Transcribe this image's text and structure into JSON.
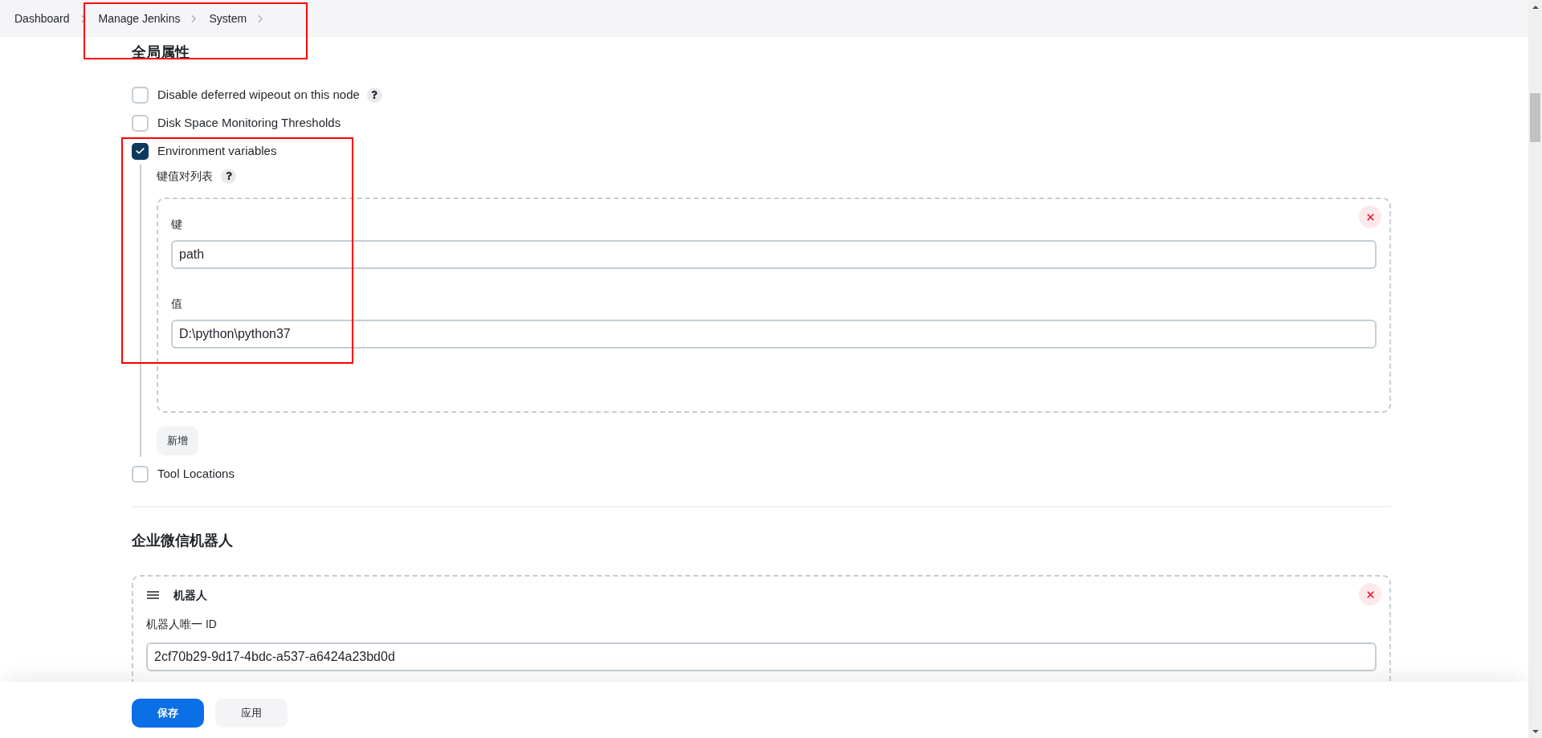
{
  "breadcrumb": {
    "highlighted": true,
    "items": [
      {
        "label": "Dashboard"
      },
      {
        "label": "Manage Jenkins"
      },
      {
        "label": "System"
      }
    ]
  },
  "global_properties": {
    "title": "全局属性",
    "options": [
      {
        "label": "Disable deferred wipeout on this node",
        "checked": false,
        "help": true,
        "highlighted": false
      },
      {
        "label": "Disk Space Monitoring Thresholds",
        "checked": false,
        "help": false,
        "highlighted": false
      },
      {
        "label": "Environment variables",
        "checked": true,
        "help": false,
        "highlighted": true,
        "settings": {
          "list_label": "键值对列表",
          "list_help": true,
          "entries": [
            {
              "fields": [
                {
                  "label": "键",
                  "value": "path"
                },
                {
                  "label": "值",
                  "value": "D:\\python\\python37"
                }
              ]
            }
          ],
          "add_button": "新增"
        }
      },
      {
        "label": "Tool Locations",
        "checked": false,
        "help": false,
        "highlighted": false
      }
    ]
  },
  "wecom_robot": {
    "title": "企业微信机器人",
    "robots": [
      {
        "name": "机器人",
        "fields": [
          {
            "label": "机器人唯一 ID",
            "value": "2cf70b29-9d17-4bdc-a537-a6424a23bd0d"
          }
        ]
      }
    ]
  },
  "footer": {
    "buttons": [
      {
        "label": "保存",
        "kind": "primary"
      },
      {
        "label": "应用",
        "kind": "secondary"
      }
    ]
  }
}
